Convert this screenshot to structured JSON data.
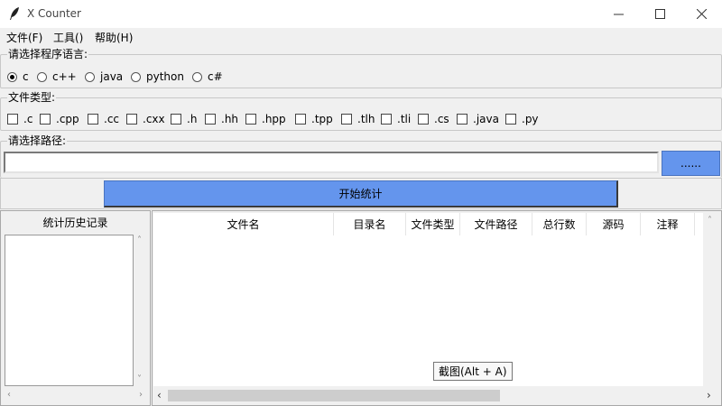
{
  "window": {
    "title": "X Counter",
    "icon": "feather-icon"
  },
  "menu": {
    "file": "文件(F)",
    "tools": "工具()",
    "help": "帮助(H)"
  },
  "language_group": {
    "label": "请选择程序语言:",
    "options": [
      "c",
      "c++",
      "java",
      "python",
      "c#"
    ],
    "selected": "c"
  },
  "filetype_group": {
    "label": "文件类型:",
    "options": [
      ".c",
      ".cpp",
      ".cc",
      ".cxx",
      ".h",
      ".hh",
      ".hpp",
      ".tpp",
      ".tlh",
      ".tli",
      ".cs",
      ".java",
      ".py"
    ]
  },
  "path_group": {
    "label": "请选择路径:",
    "value": "",
    "browse_label": "......"
  },
  "start_button": "开始统计",
  "history": {
    "header": "统计历史记录"
  },
  "table": {
    "columns": [
      "文件名",
      "目录名",
      "文件类型",
      "文件路径",
      "总行数",
      "源码",
      "注释"
    ]
  },
  "tooltip": "截图(Alt + A)",
  "colors": {
    "accent": "#6495ed",
    "window_bg": "#f0f0f0"
  }
}
